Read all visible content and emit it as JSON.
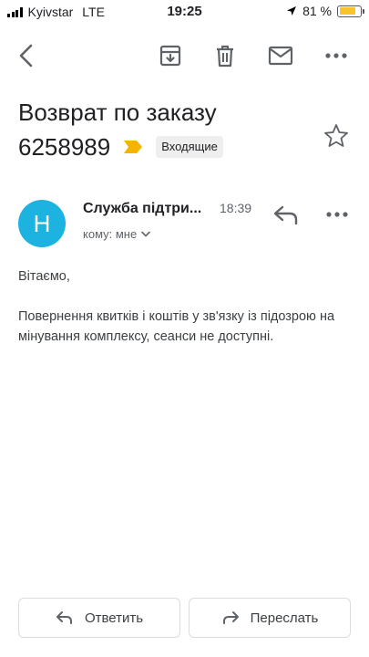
{
  "status_bar": {
    "carrier": "Kyivstar",
    "network": "LTE",
    "time": "19:25",
    "battery_percent": "81 %",
    "battery_level": 0.81,
    "battery_color": "#f7c52b",
    "icons": [
      "signal-icon",
      "location-arrow-icon",
      "battery-icon"
    ]
  },
  "toolbar": {
    "icons": [
      "back-arrow-icon",
      "archive-icon",
      "trash-icon",
      "mail-icon",
      "more-horizontal-icon"
    ]
  },
  "email": {
    "subject_line1": "Возврат по заказу",
    "subject_line2": "6258989",
    "label": "Входящие",
    "label_marker_color": "#f4b400",
    "sender_initial": "H",
    "avatar_color": "#1db3e1",
    "sender_name": "Служба підтри...",
    "time": "18:39",
    "recipient": "кому: мне",
    "greeting": "Вітаємо,",
    "body": "Повернення квитків і коштів у зв'язку із підозрою на мінування комплексу, сеанси не доступні."
  },
  "actions": {
    "reply_label": "Ответить",
    "forward_label": "Переслать"
  }
}
